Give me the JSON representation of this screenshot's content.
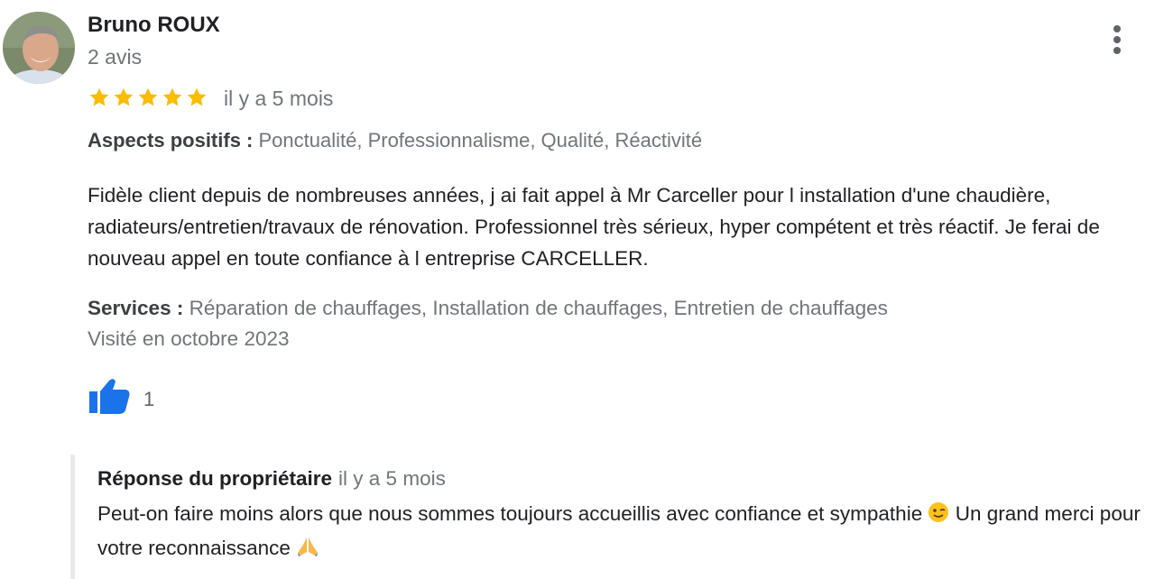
{
  "review": {
    "author_name": "Bruno ROUX",
    "review_count": "2 avis",
    "rating": 5,
    "rating_max": 5,
    "date": "il y a 5 mois",
    "aspects_label": "Aspects positifs :",
    "aspects_value": "Ponctualité, Professionnalisme, Qualité, Réactivité",
    "text": "Fidèle client depuis de nombreuses années, j ai fait appel à Mr Carceller pour l installation d'une chaudière, radiateurs/entretien/travaux de rénovation. Professionnel très sérieux, hyper compétent et très réactif. Je ferai de nouveau appel en toute confiance à l entreprise CARCELLER.",
    "services_label": "Services :",
    "services_value": "Réparation de chauffages, Installation de chauffages, Entretien de chauffages",
    "visited": "Visité en octobre 2023",
    "likes": "1"
  },
  "owner_response": {
    "title": "Réponse du propriétaire",
    "date": "il y a 5 mois",
    "text_part1": "Peut-on faire moins alors que nous sommes toujours accueillis avec confiance et sympathie",
    "text_part2": "Un grand merci pour votre reconnaissance"
  },
  "icons": {
    "avatar": "author-avatar-photo",
    "more": "more-vert-icon",
    "star": "star-icon",
    "like": "thumb-up-icon",
    "emoji_wink": "winking-face-emoji",
    "emoji_pray": "folded-hands-emoji"
  },
  "colors": {
    "star": "#fbbc04",
    "like": "#1a73e8",
    "secondary_text": "#70757a",
    "primary_text": "#202124",
    "response_border": "#e8eaed"
  }
}
